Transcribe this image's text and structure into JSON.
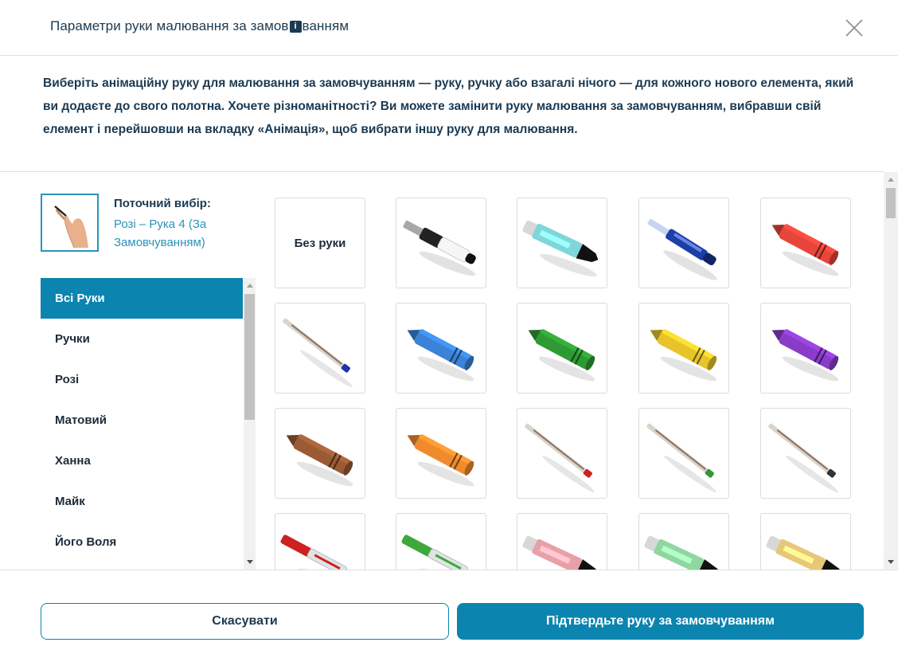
{
  "dialog": {
    "title_part1": "Параметри руки малювання за замов",
    "title_badge": "i",
    "title_part2": "ванням",
    "description": "Виберіть анімаційну руку для малювання за замовчуванням — руку, ручку або взагалі нічого — для кожного нового елемента, який ви додаєте до свого полотна. Хочете різноманітності? Ви можете замінити руку малювання за замовчуванням, вибравши свій елемент і перейшовши на вкладку «Анімація», щоб вибрати іншу руку для малювання."
  },
  "current_selection": {
    "label": "Поточний вибір:",
    "value": "Розі – Рука 4 (За Замовчуванням)"
  },
  "categories": [
    {
      "label": "Всі Руки",
      "active": true
    },
    {
      "label": "Ручки",
      "active": false
    },
    {
      "label": "Розі",
      "active": false
    },
    {
      "label": "Матовий",
      "active": false
    },
    {
      "label": "Ханна",
      "active": false
    },
    {
      "label": "Майк",
      "active": false
    },
    {
      "label": "Його Воля",
      "active": false
    }
  ],
  "tiles": {
    "no_hand_label": "Без руки",
    "items": [
      {
        "kind": "none"
      },
      {
        "kind": "pen-white",
        "color": "#ffffff",
        "tip": "#111111"
      },
      {
        "kind": "marker",
        "color": "#7ed6d8",
        "tip": "#111111"
      },
      {
        "kind": "pen-blue",
        "color": "#1e3ea8",
        "tip": "#1e3ea8"
      },
      {
        "kind": "crayon",
        "color": "#e8453a"
      },
      {
        "kind": "ballpoint",
        "color": "#2233aa"
      },
      {
        "kind": "crayon",
        "color": "#3b82d8"
      },
      {
        "kind": "crayon",
        "color": "#2f9a34"
      },
      {
        "kind": "crayon",
        "color": "#e6c42a"
      },
      {
        "kind": "crayon",
        "color": "#8a3cc8"
      },
      {
        "kind": "crayon",
        "color": "#9a5a34"
      },
      {
        "kind": "crayon",
        "color": "#f08a2c"
      },
      {
        "kind": "ballpoint",
        "color": "#cc2222"
      },
      {
        "kind": "ballpoint",
        "color": "#2f9a34"
      },
      {
        "kind": "ballpoint",
        "color": "#333333"
      },
      {
        "kind": "pen-clear",
        "color": "#cc2222"
      },
      {
        "kind": "pen-clear",
        "color": "#3ea83a"
      },
      {
        "kind": "marker",
        "color": "#e8a0a8",
        "tip": "#111111"
      },
      {
        "kind": "marker",
        "color": "#8fd6a0",
        "tip": "#111111"
      },
      {
        "kind": "marker",
        "color": "#e6c878",
        "tip": "#111111"
      }
    ]
  },
  "buttons": {
    "cancel": "Скасувати",
    "confirm": "Підтвердьте руку за замовчуванням"
  },
  "colors": {
    "accent": "#0b84b0",
    "title": "#1b3a52",
    "link": "#2a93b8"
  }
}
